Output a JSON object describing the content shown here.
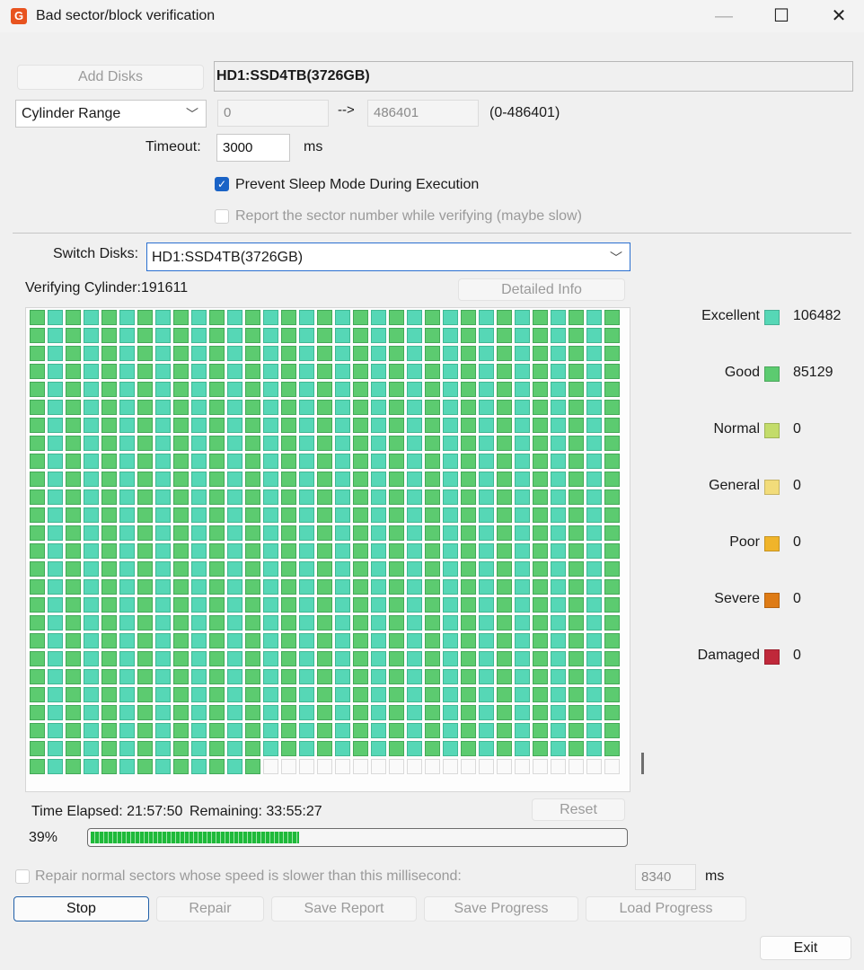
{
  "window": {
    "title": "Bad sector/block verification",
    "minimize_glyph": "—",
    "maximize_glyph": "☐",
    "close_glyph": "✕"
  },
  "toolbar": {
    "add_disks_label": "Add Disks",
    "selected_disk": "HD1:SSD4TB(3726GB)"
  },
  "range": {
    "mode": "Cylinder Range",
    "start": "0",
    "arrow": "-->",
    "end": "486401",
    "bounds": "(0-486401)"
  },
  "timeout": {
    "label": "Timeout:",
    "value": "3000",
    "unit": "ms"
  },
  "options": {
    "prevent_sleep": {
      "label": "Prevent Sleep Mode During Execution",
      "checked": true
    },
    "report_sector": {
      "label": "Report the sector number while verifying (maybe slow)",
      "checked": false
    }
  },
  "switch_disks": {
    "label": "Switch Disks:",
    "value": "HD1:SSD4TB(3726GB)"
  },
  "verifying": {
    "text": "Verifying Cylinder:191611",
    "detailed_info_label": "Detailed Info"
  },
  "grid": {
    "columns": 33,
    "rows": 26,
    "filled_last_row": 13,
    "scan_pattern": "alternating excellent/good",
    "colors": {
      "excellent": "#56d7b6",
      "good": "#5ccb70",
      "empty": "#fafafa"
    }
  },
  "legend": [
    {
      "label": "Excellent",
      "color": "#56d7b6",
      "value": "106482"
    },
    {
      "label": "Good",
      "color": "#5ccb70",
      "value": "85129"
    },
    {
      "label": "Normal",
      "color": "#c3dc6a",
      "value": "0"
    },
    {
      "label": "General",
      "color": "#f2dc7a",
      "value": "0"
    },
    {
      "label": "Poor",
      "color": "#f0b42a",
      "value": "0"
    },
    {
      "label": "Severe",
      "color": "#de7b15",
      "value": "0"
    },
    {
      "label": "Damaged",
      "color": "#c0283a",
      "value": "0"
    }
  ],
  "status": {
    "time_elapsed": "Time Elapsed: 21:57:50",
    "remaining": "Remaining: 33:55:27",
    "reset_label": "Reset",
    "percent_label": "39%",
    "progress": 0.39
  },
  "repair_option": {
    "label": "Repair normal sectors whose speed is slower than this millisecond:",
    "value": "8340",
    "unit": "ms",
    "checked": false
  },
  "buttons": {
    "stop": "Stop",
    "repair": "Repair",
    "save_report": "Save Report",
    "save_progress": "Save Progress",
    "load_progress": "Load Progress",
    "exit": "Exit"
  }
}
